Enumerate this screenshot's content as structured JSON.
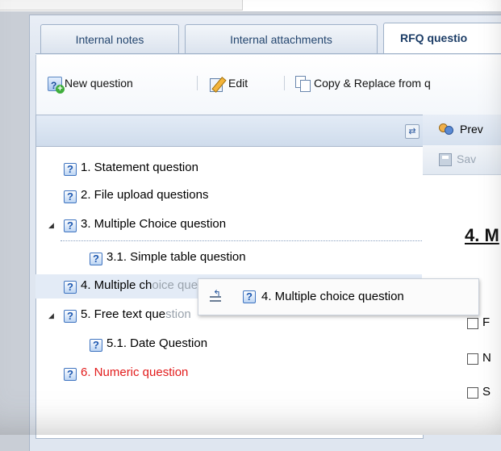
{
  "tabs": [
    {
      "label": "Internal notes"
    },
    {
      "label": "Internal attachments"
    },
    {
      "label": "RFQ questio",
      "active": true
    }
  ],
  "toolbar": {
    "new_question": "New question",
    "edit": "Edit",
    "copy_replace": "Copy & Replace from q"
  },
  "tree": {
    "items": [
      {
        "label": "1. Statement question"
      },
      {
        "label": "2. File upload questions"
      },
      {
        "label": "3. Multiple Choice question",
        "expanded": true
      },
      {
        "label": "3.1. Simple table question"
      },
      {
        "label": "4. Multiple ch",
        "ghosted_tail": "oice question"
      },
      {
        "label": "5. Free text que",
        "ghosted_tail": "stion",
        "expanded": true
      },
      {
        "label": "5.1. Date Question"
      },
      {
        "label": "6. Numeric question",
        "color": "#e21c1c"
      }
    ]
  },
  "drag_ghost": {
    "label": "4. Multiple choice question"
  },
  "right": {
    "preview_label": "Prev",
    "save_label": "Sav",
    "title": "4. M",
    "options": [
      "F",
      "N",
      "S"
    ]
  }
}
